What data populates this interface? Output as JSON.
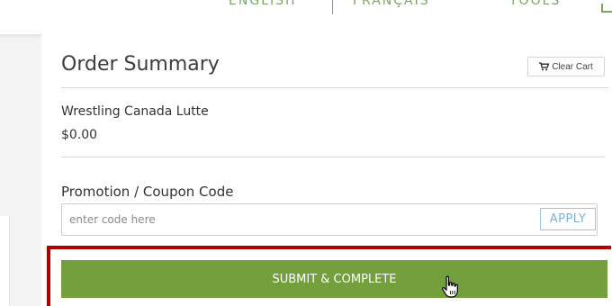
{
  "nav": {
    "english": "ENGLISH",
    "separator": "|",
    "francais": "FRANÇAIS",
    "tools": "TOOLS"
  },
  "order": {
    "title": "Order Summary",
    "clear_cart_label": "Clear Cart",
    "clear_cart_icon": "cart-icon",
    "item_name": "Wrestling Canada Lutte",
    "item_price": "$0.00"
  },
  "promo": {
    "label": "Promotion / Coupon Code",
    "placeholder": "enter code here",
    "value": "",
    "apply_label": "APPLY"
  },
  "submit": {
    "label": "SUBMIT & COMPLETE"
  },
  "colors": {
    "accent_green": "#73a03c",
    "nav_green": "#7aa864",
    "highlight_red": "#b00000",
    "apply_blue": "#7eb2dc"
  }
}
